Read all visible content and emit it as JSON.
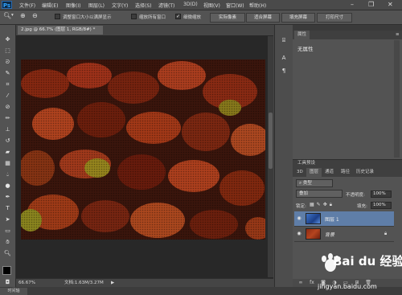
{
  "menu": {
    "logo": "Ps",
    "items": [
      "文件(F)",
      "编辑(E)",
      "图像(I)",
      "图层(L)",
      "文字(Y)",
      "选择(S)",
      "滤镜(T)",
      "3D(D)",
      "视图(V)",
      "窗口(W)",
      "帮助(H)"
    ]
  },
  "options": {
    "checkbox1_label": "调整窗口大小以满屏显示",
    "checkbox2_label": "缩放所有窗口",
    "checkbox3_label": "细微缩放",
    "btn_actual_pixels": "实际像素",
    "btn_fit_screen": "适合屏幕",
    "btn_fill_screen": "填充屏幕",
    "btn_print_size": "打印尺寸"
  },
  "document": {
    "tab_title": "2.jpg @ 66.7% (图层 1, RGB/8#) *",
    "zoom": "66.67%",
    "doc_info": "文档:1.63M/3.27M"
  },
  "bottom_tab": "时间轴",
  "properties_panel": {
    "tab": "属性",
    "body": "无属性"
  },
  "layers_panel": {
    "top_label": "工具预设",
    "tabs": [
      "3D",
      "图层",
      "通道",
      "路径",
      "历史记录"
    ],
    "kind_filter": "类型",
    "blend_mode": "叠加",
    "opacity_label": "不透明度:",
    "opacity_value": "100%",
    "lock_label": "锁定:",
    "fill_label": "填充:",
    "fill_value": "100%",
    "layers": [
      {
        "name": "图层 1",
        "selected": true
      },
      {
        "name": "背景",
        "selected": false
      }
    ]
  },
  "watermark": {
    "brand": "Bai du 经验",
    "url": "jingyan.baidu.com"
  }
}
